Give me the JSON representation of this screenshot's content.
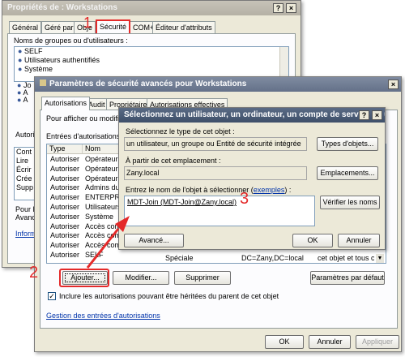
{
  "window1": {
    "title": "Propriétés de : Workstations",
    "tabs": [
      "Général",
      "Géré par",
      "Obje",
      "Sécurité",
      "COM+",
      "Éditeur d'attributs"
    ],
    "groups_label": "Noms de groupes ou d'utilisateurs :",
    "users": [
      "SELF",
      "Utilisateurs authentifiés",
      "Système",
      "Jo",
      "A",
      "A"
    ],
    "side_text": [
      "Autori",
      "Pour le",
      "Avanc",
      "Inform"
    ],
    "perm_items": [
      "Cont",
      "Lire",
      "Écrir",
      "Crée",
      "Supp"
    ]
  },
  "window2": {
    "title": "Paramètres de sécurité avancés pour Workstations",
    "tabs": [
      "Autorisations",
      "Audit",
      "Propriétaire",
      "Autorisations effectives"
    ],
    "instruction": "Pour afficher ou modifier le",
    "entries_label": "Entrées d'autorisations :",
    "columns": [
      "Type",
      "Nom"
    ],
    "rows": [
      {
        "type": "Autoriser",
        "name": "Opérateurs d"
      },
      {
        "type": "Autoriser",
        "name": "Opérateurs d"
      },
      {
        "type": "Autoriser",
        "name": "Opérateurs d"
      },
      {
        "type": "Autoriser",
        "name": "Admins du d"
      },
      {
        "type": "Autoriser",
        "name": "ENTERPRIS"
      },
      {
        "type": "Autoriser",
        "name": "Utilisateurs a"
      },
      {
        "type": "Autoriser",
        "name": "Système"
      },
      {
        "type": "Autoriser",
        "name": "Accès comp"
      },
      {
        "type": "Autoriser",
        "name": "Accès comp"
      },
      {
        "type": "Autoriser",
        "name": "Accès comp"
      },
      {
        "type": "Autoriser",
        "name": "SELF"
      }
    ],
    "last_row_extra": {
      "access": "Spéciale",
      "inherited": "DC=Zany,DC=local",
      "applies": "cet objet et tous ceux dev..."
    },
    "add_button": "Ajouter...",
    "edit_button": "Modifier...",
    "remove_button": "Supprimer",
    "default_button": "Paramètres par défaut",
    "inherit_checkbox": "Inclure les autorisations pouvant être héritées du parent de cet objet",
    "inherit_checked": true,
    "manage_link": "Gestion des entrées d'autorisations",
    "ok": "OK",
    "cancel": "Annuler",
    "apply": "Appliquer"
  },
  "window3": {
    "title": "Sélectionnez un utilisateur, un ordinateur, un compte de service ou un groupe",
    "type_label": "Sélectionnez le type de cet objet :",
    "type_value": "un utilisateur, un groupe ou Entité de sécurité intégrée",
    "types_button": "Types d'objets...",
    "location_label": "À partir de cet emplacement :",
    "location_value": "Zany.local",
    "locations_button": "Emplacements...",
    "enter_label_prefix": "Entrez le nom de l'objet à sélectionner (",
    "enter_label_link": "exemples",
    "enter_label_suffix": ") :",
    "entered_name": "MDT-Join (MDT-Join@Zany.local)",
    "check_button": "Vérifier les noms",
    "advanced_button": "Avancé...",
    "ok": "OK",
    "cancel": "Annuler"
  },
  "annotations": {
    "step1": "1",
    "step2": "2",
    "step3": "3",
    "color": "#e42a2a"
  }
}
